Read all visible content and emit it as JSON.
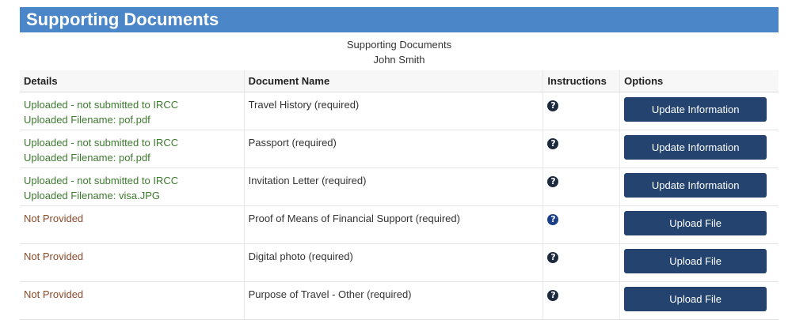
{
  "panel": {
    "title": "Supporting Documents",
    "subtitle": "Supporting Documents",
    "applicant": "John Smith"
  },
  "table": {
    "headers": {
      "details": "Details",
      "document_name": "Document Name",
      "instructions": "Instructions",
      "options": "Options"
    },
    "rows": [
      {
        "status": "Uploaded - not submitted to IRCC",
        "filename": "Uploaded Filename:  pof.pdf",
        "document": "Travel History  (required)",
        "help_glyph": "?",
        "action": "Update Information"
      },
      {
        "status": "Uploaded - not submitted to IRCC",
        "filename": "Uploaded Filename:  pof.pdf",
        "document": "Passport  (required)",
        "help_glyph": "?",
        "action": "Update Information"
      },
      {
        "status": "Uploaded - not submitted to IRCC",
        "filename": "Uploaded Filename:  visa.JPG",
        "document": "Invitation Letter  (required)",
        "help_glyph": "?",
        "action": "Update Information"
      },
      {
        "status": "Not Provided",
        "filename": "",
        "document": "Proof of Means of Financial Support  (required)",
        "help_glyph": "?",
        "action": "Upload File"
      },
      {
        "status": "Not Provided",
        "filename": "",
        "document": "Digital photo  (required)",
        "help_glyph": "?",
        "action": "Upload File"
      },
      {
        "status": "Not Provided",
        "filename": "",
        "document": "Purpose of Travel - Other  (required)",
        "help_glyph": "?",
        "action": "Upload File"
      }
    ]
  },
  "colors": {
    "header_bar": "#4a86c8",
    "button": "#24446f",
    "status_uploaded": "#3c7a2e",
    "status_missing": "#8a4a2a"
  },
  "icons": {
    "help": "question-circle-icon"
  }
}
